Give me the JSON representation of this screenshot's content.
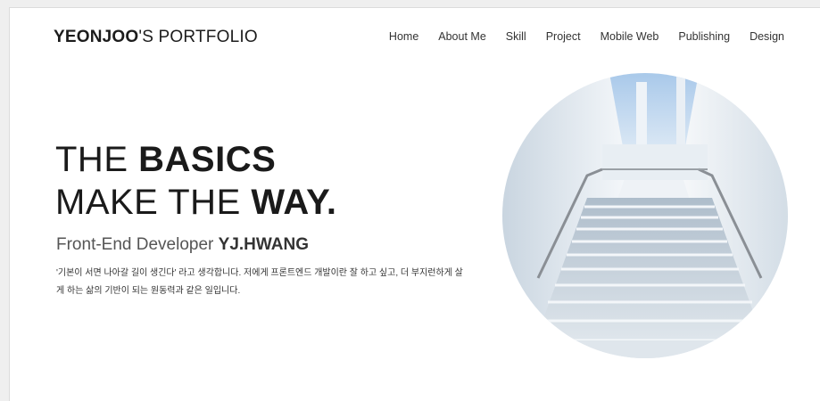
{
  "header": {
    "logo_bold": "YEONJOO",
    "logo_rest": "'S PORTFOLIO",
    "nav": [
      "Home",
      "About Me",
      "Skill",
      "Project",
      "Mobile Web",
      "Publishing",
      "Design"
    ]
  },
  "hero": {
    "line1_light": "THE ",
    "line1_bold": "BASICS",
    "line2_light": "MAKE THE ",
    "line2_bold": "WAY.",
    "subtitle_light": "Front-End Developer ",
    "subtitle_bold": "YJ.HWANG",
    "description": "'기본이 서면 나아갈 길이 생긴다' 라고 생각합니다. 저에게 프론트엔드 개발이란 잘 하고 싶고, 더 부지런하게 살게 하는 삶의 기반이 되는 원동력과 같은 일입니다."
  },
  "colors": {
    "background": "#ffffff",
    "text": "#1a1a1a"
  }
}
